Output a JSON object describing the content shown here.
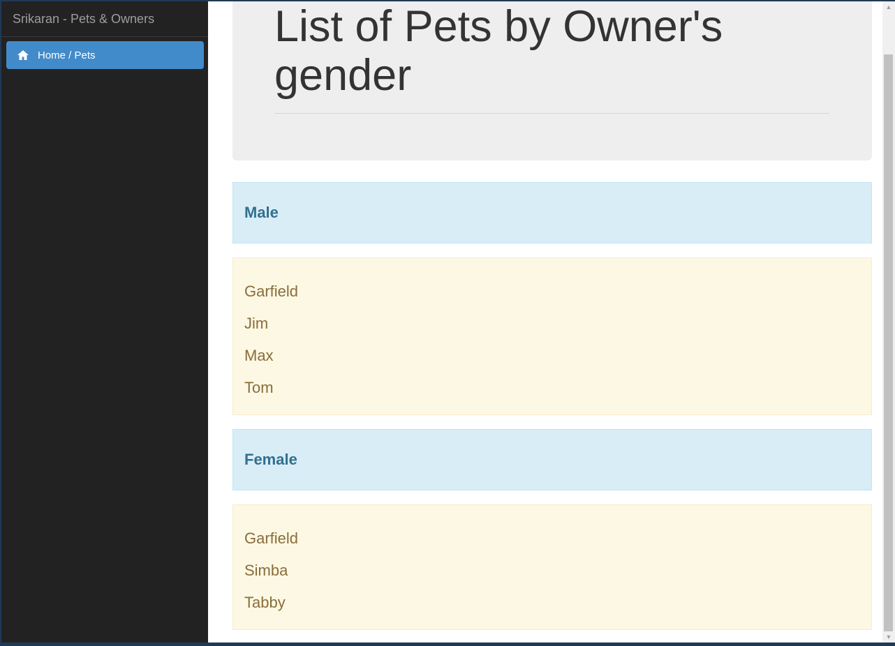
{
  "sidebar": {
    "brand": "Srikaran - Pets & Owners",
    "nav": [
      {
        "label": "Home / Pets",
        "icon": "home-icon",
        "active": true
      }
    ]
  },
  "main": {
    "title": "List of Pets by Owner's gender",
    "groups": [
      {
        "heading": "Male",
        "pets": [
          "Garfield",
          "Jim",
          "Max",
          "Tom"
        ]
      },
      {
        "heading": "Female",
        "pets": [
          "Garfield",
          "Simba",
          "Tabby"
        ]
      }
    ]
  },
  "colors": {
    "sidebar_bg": "#222222",
    "nav_active": "#428bca",
    "heading_bg": "#d9edf7",
    "heading_text": "#31708f",
    "list_bg": "#fcf8e3",
    "list_text": "#8a6d3b"
  }
}
